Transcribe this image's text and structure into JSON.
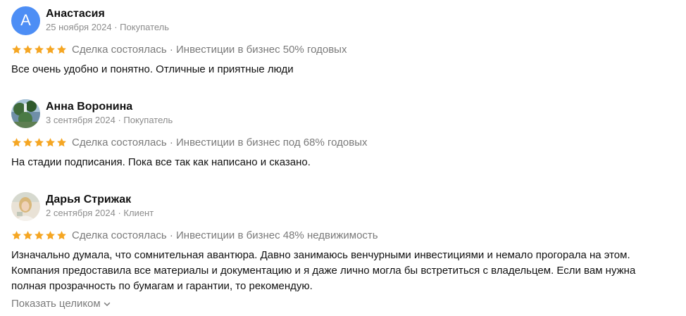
{
  "colors": {
    "star": "#f5a623",
    "avatar_letter_bg": "#4d8ef5",
    "secondary_text": "#8c8c8c"
  },
  "reviews": [
    {
      "avatar_letter": "А",
      "name": "Анастасия",
      "date_role": "25 ноября 2024 · Покупатель",
      "rating": 5,
      "deal": "Сделка состоялась · Инвестиции в бизнес 50% годовых",
      "text": "Все очень удобно и понятно. Отличные и приятные люди"
    },
    {
      "avatar_icon": "user-photo",
      "name": "Анна Воронина",
      "date_role": "3 сентября 2024 · Покупатель",
      "rating": 5,
      "deal": "Сделка состоялась · Инвестиции в бизнес под 68% годовых",
      "text": "На стадии подписания. Пока все так как написано и сказано."
    },
    {
      "avatar_icon": "user-photo",
      "name": "Дарья Стрижак",
      "date_role": "2 сентября 2024 · Клиент",
      "rating": 5,
      "deal": "Сделка состоялась · Инвестиции в бизнес 48% недвижимость",
      "text": "Изначально думала, что сомнительная авантюра. Давно занимаюсь венчурными инвестициями и немало прогорала на этом. Компания предоставила все материалы и документацию и я даже лично могла бы встретиться с владельцем. Если вам нужна полная прозрачность по бумагам и гарантии, то рекомендую.",
      "show_more_label": "Показать целиком"
    }
  ]
}
